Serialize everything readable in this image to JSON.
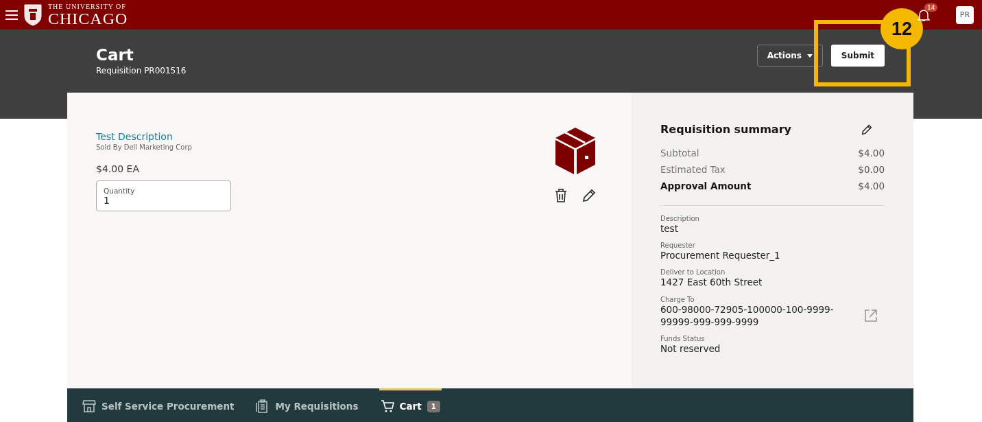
{
  "header": {
    "logo_line_1": "THE UNIVERSITY OF",
    "logo_line_2": "CHICAGO",
    "notification_count": "14",
    "avatar_initials": "PR"
  },
  "page": {
    "title": "Cart",
    "subtitle": "Requisition PR001516",
    "actions_label": "Actions",
    "submit_label": "Submit"
  },
  "callout": {
    "number": "12"
  },
  "item": {
    "name": "Test Description",
    "seller": "Sold By Dell Marketing Corp",
    "price": "$4.00 EA",
    "quantity_label": "Quantity",
    "quantity": "1"
  },
  "summary": {
    "title": "Requisition summary",
    "totals": [
      {
        "label": "Subtotal",
        "value": "$4.00",
        "emphasis": false
      },
      {
        "label": "Estimated Tax",
        "value": "$0.00",
        "emphasis": false
      },
      {
        "label": "Approval Amount",
        "value": "$4.00",
        "emphasis": true
      }
    ],
    "fields": [
      {
        "label": "Description",
        "value": "test",
        "link": false
      },
      {
        "label": "Requester",
        "value": "Procurement Requester_1",
        "link": false
      },
      {
        "label": "Deliver to Location",
        "value": "1427 East 60th Street",
        "link": false
      },
      {
        "label": "Charge To",
        "value": "600-98000-72905-100000-100-9999-99999-999-999-9999",
        "link": true
      },
      {
        "label": "Funds Status",
        "value": "Not reserved",
        "link": false
      }
    ]
  },
  "bottom_nav": [
    {
      "label": "Self Service Procurement",
      "kind": "store",
      "selected": false
    },
    {
      "label": "My Requisitions",
      "kind": "clipboard",
      "selected": false
    },
    {
      "label": "Cart",
      "kind": "cart",
      "selected": true,
      "badge": "1"
    }
  ]
}
